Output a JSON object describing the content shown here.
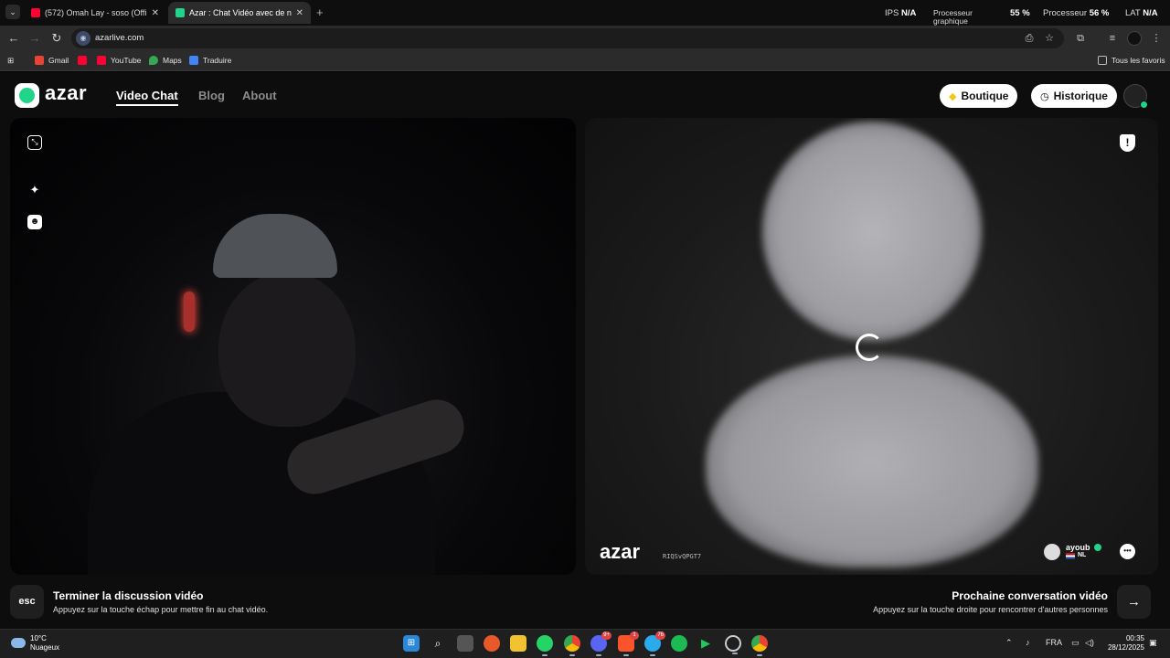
{
  "browser": {
    "tabs": [
      {
        "title": "(572) Omah Lay - soso (Offi",
        "favicon": "youtube-icon",
        "color": "#ff0033",
        "active": false
      },
      {
        "title": "Azar : Chat Vidéo avec de n",
        "favicon": "azar-icon",
        "color": "#21d48a",
        "active": true
      }
    ],
    "perf": {
      "ips_label": "IPS",
      "ips_value": "N/A",
      "gpu_label_1": "Processeur",
      "gpu_label_2": "graphique",
      "gpu_value": "55 %",
      "cpu_label": "Processeur",
      "cpu_value": "56 %",
      "lat_label": "LAT",
      "lat_value": "N/A"
    },
    "url": "azarlive.com",
    "bookmarks": [
      "Gmail",
      "YouTube",
      "Maps",
      "Traduire"
    ],
    "all_bookmarks": "Tous les favoris"
  },
  "site": {
    "logo": "azar",
    "nav": [
      "Video Chat",
      "Blog",
      "About"
    ],
    "shop_label": "Boutique",
    "history_label": "Historique",
    "watermark": "azar",
    "session_id": "RIQSvQPGT7",
    "peer": {
      "name": "ayoub",
      "country": "NL"
    },
    "end": {
      "key": "esc",
      "title": "Terminer la discussion vidéo",
      "subtitle": "Appuyez sur la touche échap pour mettre fin au chat vidéo."
    },
    "next": {
      "key": "→",
      "title": "Prochaine conversation vidéo",
      "subtitle": "Appuyez sur la touche droite pour rencontrer d'autres personnes"
    }
  },
  "taskbar": {
    "weather_temp": "10°C",
    "weather_desc": "Nuageux",
    "language": "FRA",
    "time": "00:35",
    "date": "28/12/2025",
    "badges": {
      "discord": "9+",
      "brave": "1",
      "telegram": "76"
    }
  }
}
